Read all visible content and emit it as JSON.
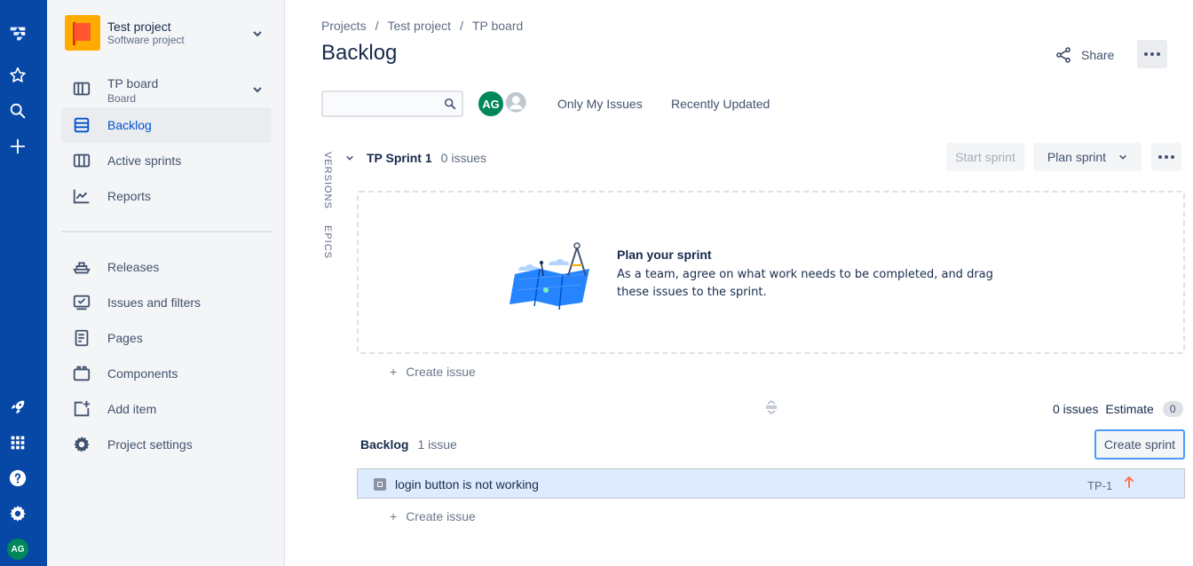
{
  "global_nav": {
    "icons": [
      "jira-logo-icon",
      "star-icon",
      "search-icon",
      "plus-icon",
      "rocket-icon",
      "app-grid-icon",
      "help-icon",
      "gear-icon"
    ],
    "avatar_initials": "AG"
  },
  "sidebar": {
    "project_name": "Test project",
    "project_type": "Software project",
    "board_name": "TP board",
    "board_type": "Board",
    "items": [
      {
        "label": "Backlog"
      },
      {
        "label": "Active sprints"
      },
      {
        "label": "Reports"
      },
      {
        "label": "Releases"
      },
      {
        "label": "Issues and filters"
      },
      {
        "label": "Pages"
      },
      {
        "label": "Components"
      },
      {
        "label": "Add item"
      },
      {
        "label": "Project settings"
      }
    ]
  },
  "header": {
    "breadcrumbs": [
      "Projects",
      "Test project",
      "TP board"
    ],
    "breadcrumb_sep": "/",
    "title": "Backlog",
    "share_label": "Share"
  },
  "filters": {
    "search_placeholder": "",
    "avatar_initials": "AG",
    "quick_filters": [
      "Only My Issues",
      "Recently Updated"
    ]
  },
  "side_tabs": [
    "VERSIONS",
    "EPICS"
  ],
  "sprint": {
    "name": "TP Sprint 1",
    "count": "0 issues",
    "start_label": "Start sprint",
    "plan_label": "Plan sprint",
    "empty_title": "Plan your sprint",
    "empty_desc": "As a team, agree on what work needs to be completed, and drag these issues to the sprint.",
    "create_issue": "Create issue"
  },
  "estimate": {
    "issues": "0 issues",
    "label": "Estimate",
    "value": "0"
  },
  "backlog": {
    "title": "Backlog",
    "count": "1 issue",
    "create_sprint": "Create sprint",
    "create_issue": "Create issue",
    "issues": [
      {
        "summary": "login button is not working",
        "key": "TP-1",
        "priority": "high"
      }
    ]
  },
  "colors": {
    "nav_bg": "#0747a6",
    "accent": "#0052cc",
    "avatar_green": "#00875a",
    "priority_orange": "#ff7452",
    "selected_row": "#deebff"
  }
}
